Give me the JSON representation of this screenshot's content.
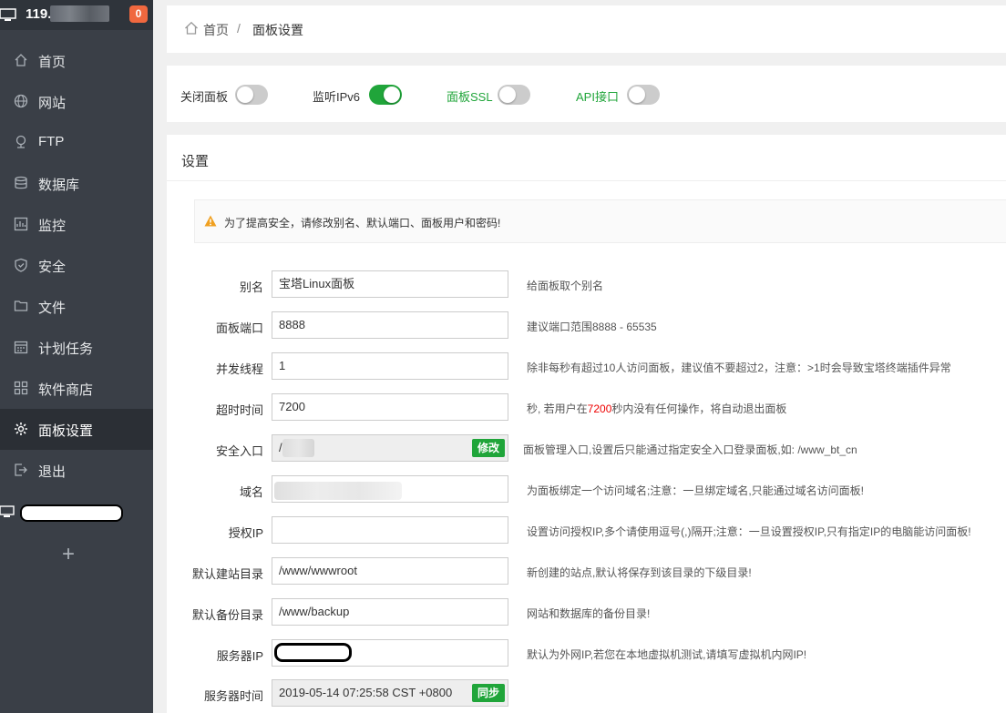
{
  "sidebar": {
    "server_ip": "119.",
    "badge": "0",
    "items": [
      {
        "label": "首页",
        "icon": "home-icon"
      },
      {
        "label": "网站",
        "icon": "globe-icon"
      },
      {
        "label": "FTP",
        "icon": "ftp-icon"
      },
      {
        "label": "数据库",
        "icon": "database-icon"
      },
      {
        "label": "监控",
        "icon": "monitor-chart-icon"
      },
      {
        "label": "安全",
        "icon": "shield-icon"
      },
      {
        "label": "文件",
        "icon": "folder-icon"
      },
      {
        "label": "计划任务",
        "icon": "calendar-icon"
      },
      {
        "label": "软件商店",
        "icon": "apps-grid-icon"
      },
      {
        "label": "面板设置",
        "icon": "gear-icon"
      },
      {
        "label": "退出",
        "icon": "logout-icon"
      }
    ],
    "active_index": 9,
    "add_label": "+"
  },
  "breadcrumb": {
    "home": "首页",
    "separator": "/",
    "current": "面板设置"
  },
  "toggles": [
    {
      "label": "关闭面板",
      "on": false,
      "green": false
    },
    {
      "label": "监听IPv6",
      "on": true,
      "green": false
    },
    {
      "label": "面板SSL",
      "on": false,
      "green": true
    },
    {
      "label": "API接口",
      "on": false,
      "green": true
    }
  ],
  "settings": {
    "title": "设置",
    "warning": "为了提高安全，请修改别名、默认端口、面板用户和密码!",
    "fields": [
      {
        "label": "别名",
        "value": "宝塔Linux面板",
        "help": "给面板取个别名"
      },
      {
        "label": "面板端口",
        "value": "8888",
        "help": "建议端口范围8888 - 65535"
      },
      {
        "label": "并发线程",
        "value": "1",
        "help": "除非每秒有超过10人访问面板，建议值不要超过2，注意：>1时会导致宝塔终端插件异常"
      },
      {
        "label": "超时时间",
        "value": "7200",
        "help_pre": "秒, 若用户在",
        "help_red": "7200",
        "help_post": "秒内没有任何操作，将自动退出面板"
      },
      {
        "label": "安全入口",
        "value": "/",
        "button": "修改",
        "help": "面板管理入口,设置后只能通过指定安全入口登录面板,如: /www_bt_cn"
      },
      {
        "label": "域名",
        "value": "",
        "help": "为面板绑定一个访问域名;注意：一旦绑定域名,只能通过域名访问面板!"
      },
      {
        "label": "授权IP",
        "value": "",
        "help": "设置访问授权IP,多个请使用逗号(,)隔开;注意：一旦设置授权IP,只有指定IP的电脑能访问面板!"
      },
      {
        "label": "默认建站目录",
        "value": "/www/wwwroot",
        "help": "新创建的站点,默认将保存到该目录的下级目录!"
      },
      {
        "label": "默认备份目录",
        "value": "/www/backup",
        "help": "网站和数据库的备份目录!"
      },
      {
        "label": "服务器IP",
        "value": "",
        "help": "默认为外网IP,若您在本地虚拟机测试,请填写虚拟机内网IP!"
      },
      {
        "label": "服务器时间",
        "value": "2019-05-14 07:25:58 CST +0800",
        "button": "同步",
        "help": ""
      }
    ]
  },
  "colors": {
    "accent": "#20a53a",
    "sidebar": "#3a3f47",
    "badge": "#f0683f",
    "danger": "#e00"
  }
}
